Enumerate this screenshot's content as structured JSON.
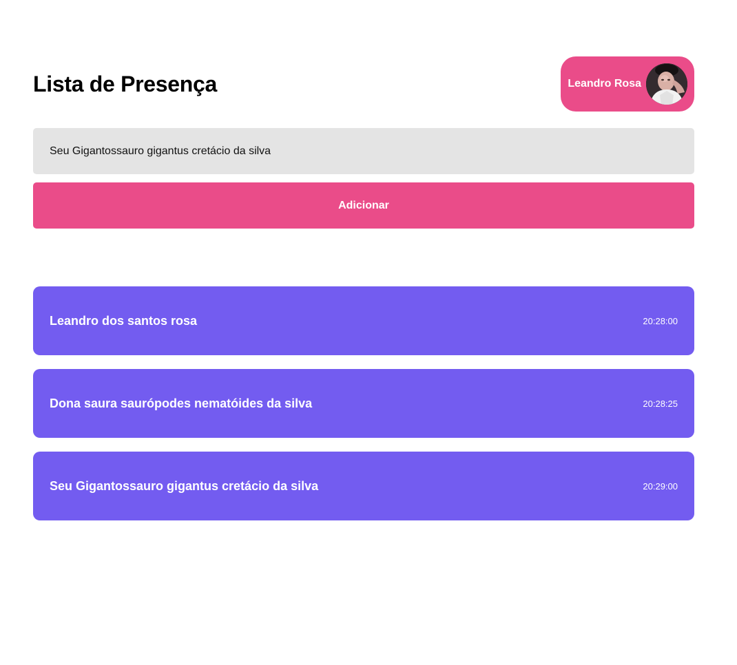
{
  "header": {
    "title": "Lista de Presença",
    "user": {
      "name": "Leandro Rosa",
      "avatar_icon": "user-avatar-photo"
    }
  },
  "form": {
    "input_value": "Seu Gigantossauro gigantus cretácio da silva",
    "add_label": "Adicionar"
  },
  "students": [
    {
      "name": "Leandro dos santos rosa",
      "time": "20:28:00"
    },
    {
      "name": "Dona saura saurópodes nematóides da silva",
      "time": "20:28:25"
    },
    {
      "name": "Seu Gigantossauro gigantus cretácio da silva",
      "time": "20:29:00"
    }
  ],
  "colors": {
    "accent_pink": "#ea4c89",
    "card_purple": "#735cf0",
    "input_bg": "#e4e4e4"
  }
}
